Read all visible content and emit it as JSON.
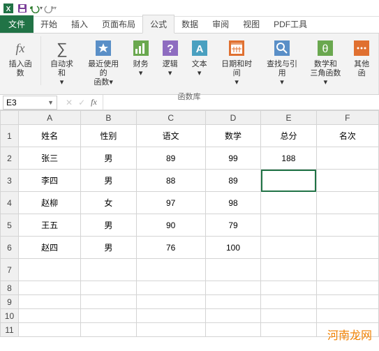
{
  "qat": {
    "app_icon": "excel-icon",
    "save_icon": "save-icon",
    "undo_icon": "undo-icon",
    "redo_icon": "redo-icon"
  },
  "tabs": {
    "file": "文件",
    "items": [
      "开始",
      "插入",
      "页面布局",
      "公式",
      "数据",
      "审阅",
      "视图",
      "PDF工具"
    ],
    "active_index": 3
  },
  "ribbon": {
    "insert_fn_label": "插入函数",
    "autosum_label": "自动求和\n▾",
    "recent_label": "最近使用的\n函数▾",
    "financial_label": "财务\n▾",
    "logical_label": "逻辑\n▾",
    "text_label": "文本\n▾",
    "datetime_label": "日期和时间\n▾",
    "lookup_label": "查找与引用\n▾",
    "math_label": "数学和\n三角函数▾",
    "other_label": "其他函",
    "group_name": "函数库"
  },
  "namebox": {
    "value": "E3"
  },
  "columns": [
    "A",
    "B",
    "C",
    "D",
    "E",
    "F"
  ],
  "rows": [
    "1",
    "2",
    "3",
    "4",
    "5",
    "6",
    "7",
    "8",
    "9",
    "10",
    "11"
  ],
  "selected": {
    "row": 3,
    "col": 5
  },
  "data": {
    "header": [
      "姓名",
      "性别",
      "语文",
      "数学",
      "总分",
      "名次"
    ],
    "body": [
      [
        "张三",
        "男",
        "89",
        "99",
        "188",
        ""
      ],
      [
        "李四",
        "男",
        "88",
        "89",
        "",
        ""
      ],
      [
        "赵柳",
        "女",
        "97",
        "98",
        "",
        ""
      ],
      [
        "王五",
        "男",
        "90",
        "79",
        "",
        ""
      ],
      [
        "赵四",
        "男",
        "76",
        "100",
        "",
        ""
      ]
    ]
  },
  "watermark": "河南龙网"
}
